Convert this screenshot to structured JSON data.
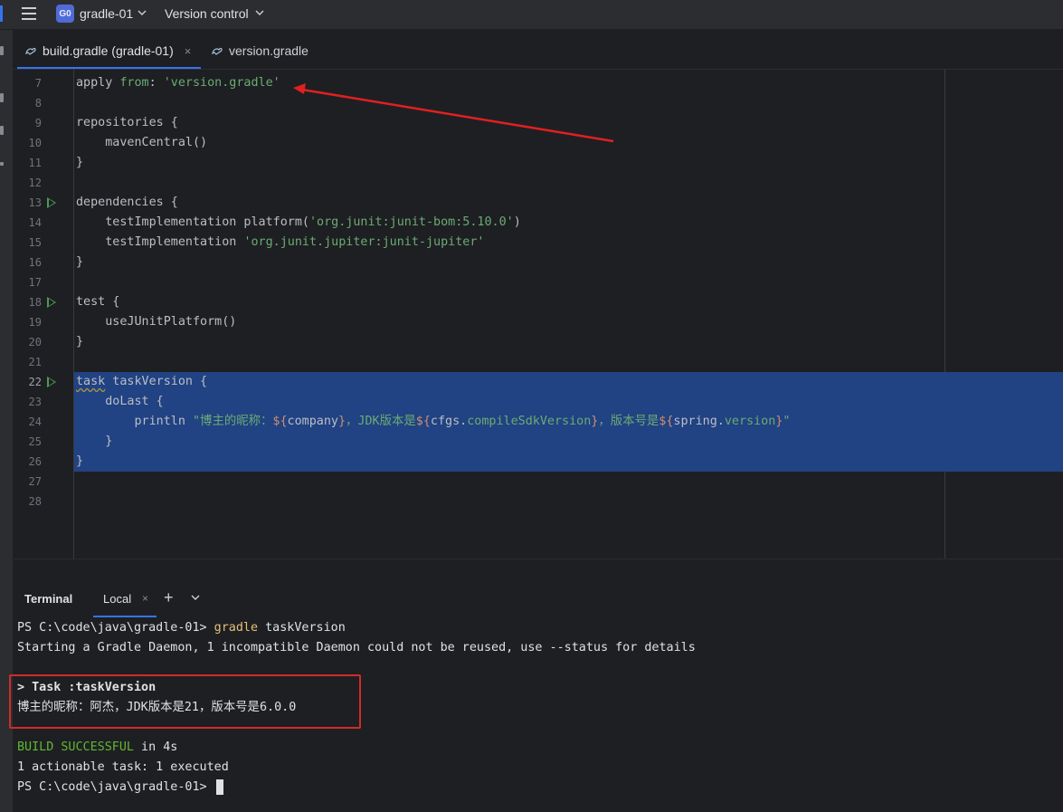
{
  "titlebar": {
    "project_badge": "G0",
    "project_name": "gradle-01",
    "vcs_label": "Version control",
    "accent": "#3574f0"
  },
  "tabs": [
    {
      "label": "build.gradle (gradle-01)",
      "close": "×",
      "active": true,
      "icon": "gradle-icon"
    },
    {
      "label": "version.gradle",
      "active": false,
      "icon": "gradle-icon"
    }
  ],
  "editor": {
    "line_numbers": [
      "7",
      "8",
      "9",
      "10",
      "11",
      "12",
      "13",
      "14",
      "15",
      "16",
      "17",
      "18",
      "19",
      "20",
      "21",
      "22",
      "23",
      "24",
      "25",
      "26",
      "27",
      "28"
    ],
    "l7": {
      "a": "apply",
      "b": " from",
      "c": ": ",
      "d": "'version.gradle'"
    },
    "l9": "repositories {",
    "l10": "    mavenCentral()",
    "l11": "}",
    "l13": "dependencies {",
    "l14": {
      "a": "    testImplementation platform(",
      "b": "'org.junit:junit-bom:5.10.0'",
      "c": ")"
    },
    "l15": {
      "a": "    testImplementation ",
      "b": "'org.junit.jupiter:junit-jupiter'"
    },
    "l16": "}",
    "l18": "test {",
    "l19": "    useJUnitPlatform()",
    "l20": "}",
    "l22": {
      "a": "task",
      "b": " taskVersion {"
    },
    "l23": "    doLast {",
    "l24": {
      "a": "        println ",
      "b": "\"博主的昵称：",
      "c": "${",
      "d": "company",
      "e": "}",
      "f": "，JDK版本是",
      "g": "${",
      "h": "cfgs.",
      "i": "compileSdkVersion",
      "j": "}",
      "k": "，版本号是",
      "l": "${",
      "m": "spring.",
      "n": "version",
      "o": "}",
      "p": "\""
    },
    "l25": "    }",
    "l26": "}"
  },
  "terminal": {
    "title": "Terminal",
    "tab_label": "Local",
    "tab_close": "×",
    "add": "+",
    "lines": {
      "prompt1_path": "PS C:\\code\\java\\gradle-01> ",
      "prompt1_cmd": "gradle",
      "prompt1_args": " taskVersion",
      "daemon": "Starting a Gradle Daemon, 1 incompatible Daemon could not be reused, use --status for details",
      "task": "> Task :taskVersion",
      "output": "博主的昵称：阿杰，JDK版本是21，版本号是6.0.0",
      "build_status": "BUILD SUCCESSFUL",
      "build_time": " in 4s",
      "actionable": "1 actionable task: 1 executed",
      "prompt2": "PS C:\\code\\java\\gradle-01> "
    }
  },
  "colors": {
    "selection": "#214283",
    "annotation": "#d12b2b",
    "string": "#6aab73",
    "success": "#5fb832"
  }
}
